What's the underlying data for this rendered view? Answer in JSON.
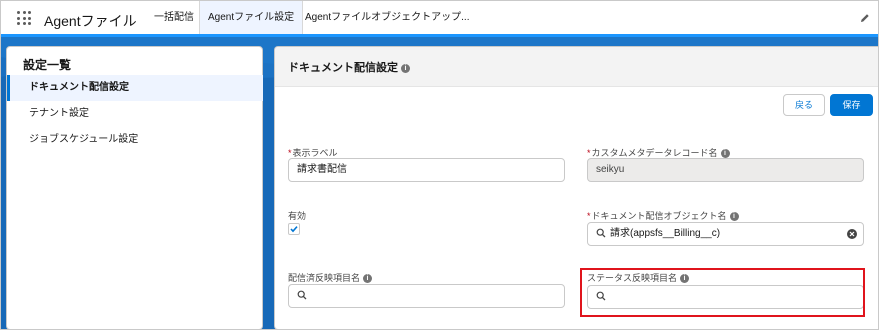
{
  "app": {
    "name": "Agentファイル"
  },
  "tabs": [
    {
      "label": "一括配信"
    },
    {
      "label": "Agentファイル設定"
    },
    {
      "label": "Agentファイルオブジェクトアップ..."
    }
  ],
  "sidebar": {
    "title": "設定一覧",
    "items": [
      {
        "label": "ドキュメント配信設定"
      },
      {
        "label": "テナント設定"
      },
      {
        "label": "ジョブスケジュール設定"
      }
    ]
  },
  "main": {
    "title": "ドキュメント配信設定",
    "buttons": {
      "back": "戻る",
      "save": "保存"
    },
    "fields": {
      "display_label": {
        "label": "表示ラベル",
        "value": "請求書配信"
      },
      "metadata_record_name": {
        "label": "カスタムメタデータレコード名",
        "value": "seikyu"
      },
      "enabled": {
        "label": "有効",
        "checked": true
      },
      "delivery_object_name": {
        "label": "ドキュメント配信オブジェクト名",
        "value": "請求(appsfs__Billing__c)"
      },
      "delivered_item_name": {
        "label": "配信済反映項目名",
        "value": ""
      },
      "status_item_name": {
        "label": "ステータス反映項目名",
        "value": ""
      }
    }
  },
  "colors": {
    "brand": "#0176d3",
    "banner": "#1769b8",
    "highlight": "#e0141c",
    "required": "#ba0517"
  }
}
